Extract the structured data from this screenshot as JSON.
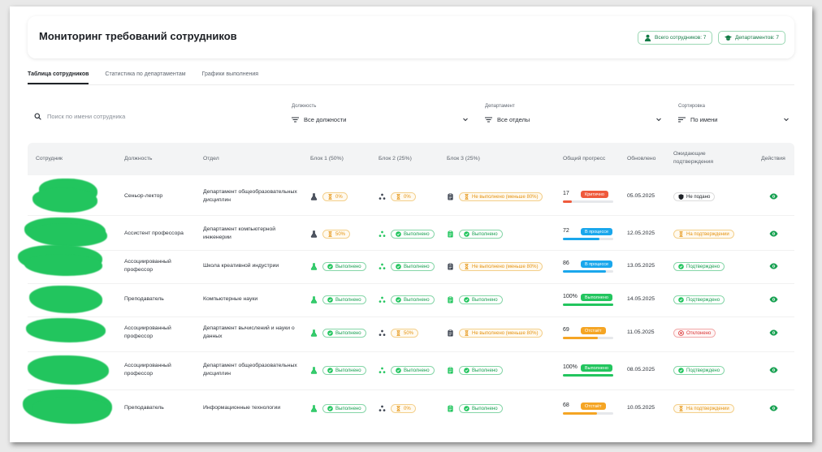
{
  "header": {
    "title": "Мониторинг требований сотрудников",
    "total_employees": "Всего сотрудников: 7",
    "departments": "Департаментов: 7"
  },
  "tabs": [
    {
      "label": "Таблица сотрудников",
      "active": true
    },
    {
      "label": "Статистика по департаментам",
      "active": false
    },
    {
      "label": "Графики выполнения",
      "active": false
    }
  ],
  "filters": {
    "search_placeholder": "Поиск по имени сотрудника",
    "position_label": "Должность",
    "position_value": "Все должности",
    "department_label": "Департамент",
    "department_value": "Все отделы",
    "sort_label": "Сортировка",
    "sort_value": "По имени"
  },
  "columns": {
    "employee": "Сотрудник",
    "position": "Должность",
    "department": "Отдел",
    "block1": "Блок 1 (50%)",
    "block2": "Блок 2 (25%)",
    "block3": "Блок 3 (25%)",
    "progress": "Общий прогресс",
    "updated": "Обновлено",
    "pending": "Ожидающие подтверждения",
    "actions": "Действия"
  },
  "colors": {
    "green": "#22c55e",
    "orange": "#f5a524",
    "red": "#ef5a3c",
    "blue": "#1aa7ec"
  },
  "rows": [
    {
      "position": "Сеньор-лектор",
      "department": "Департамент общеобразовательных дисциплин",
      "block1": {
        "status": "pending",
        "text": "0%"
      },
      "block2": {
        "status": "pending",
        "text": "0%"
      },
      "block3": {
        "status": "pending",
        "text": "Не выполнено (меньше 80%)"
      },
      "progress": {
        "value": 17,
        "label": "17",
        "badge": "Критично",
        "color": "#ef5a3c"
      },
      "updated": "05.05.2025",
      "pending": {
        "status": "dark",
        "text": "Не подано"
      }
    },
    {
      "position": "Ассистент профессора",
      "department": "Департамент компьютерной инженерии",
      "block1": {
        "status": "pending",
        "text": "50%"
      },
      "block2": {
        "status": "done",
        "text": "Выполнено"
      },
      "block3": {
        "status": "done",
        "text": "Выполнено"
      },
      "progress": {
        "value": 72,
        "label": "72",
        "badge": "В процессе",
        "color": "#1aa7ec"
      },
      "updated": "12.05.2025",
      "pending": {
        "status": "pending",
        "text": "На подтверждении"
      }
    },
    {
      "position": "Ассоциированный профессор",
      "department": "Школа креативной индустрии",
      "block1": {
        "status": "done",
        "text": "Выполнено"
      },
      "block2": {
        "status": "done",
        "text": "Выполнено"
      },
      "block3": {
        "status": "pending",
        "text": "Не выполнено (меньше 80%)"
      },
      "progress": {
        "value": 86,
        "label": "86",
        "badge": "В процессе",
        "color": "#1aa7ec"
      },
      "updated": "13.05.2025",
      "pending": {
        "status": "done",
        "text": "Подтверждено"
      }
    },
    {
      "position": "Преподаватель",
      "department": "Компьютерные науки",
      "block1": {
        "status": "done",
        "text": "Выполнено"
      },
      "block2": {
        "status": "done",
        "text": "Выполнено"
      },
      "block3": {
        "status": "done",
        "text": "Выполнено"
      },
      "progress": {
        "value": 100,
        "label": "100%",
        "badge": "Выполнено",
        "color": "#22c55e"
      },
      "updated": "14.05.2025",
      "pending": {
        "status": "done",
        "text": "Подтверждено"
      }
    },
    {
      "position": "Ассоциированный профессор",
      "department": "Департамент вычислений и науки о данных",
      "block1": {
        "status": "done",
        "text": "Выполнено"
      },
      "block2": {
        "status": "pending",
        "text": "50%"
      },
      "block3": {
        "status": "pending",
        "text": "Не выполнено (меньше 80%)"
      },
      "progress": {
        "value": 69,
        "label": "69",
        "badge": "Отстаёт",
        "color": "#f5a524"
      },
      "updated": "11.05.2025",
      "pending": {
        "status": "rejected",
        "text": "Отклонено"
      }
    },
    {
      "position": "Ассоциированный профессор",
      "department": "Департамент общеобразовательных дисциплин",
      "block1": {
        "status": "done",
        "text": "Выполнено"
      },
      "block2": {
        "status": "done",
        "text": "Выполнено"
      },
      "block3": {
        "status": "done",
        "text": "Выполнено"
      },
      "progress": {
        "value": 100,
        "label": "100%",
        "badge": "Выполнено",
        "color": "#22c55e"
      },
      "updated": "08.05.2025",
      "pending": {
        "status": "done",
        "text": "Подтверждено"
      }
    },
    {
      "position": "Преподаватель",
      "department": "Информационные технологии",
      "block1": {
        "status": "done",
        "text": "Выполнено"
      },
      "block2": {
        "status": "pending",
        "text": "0%"
      },
      "block3": {
        "status": "done",
        "text": "Выполнено"
      },
      "progress": {
        "value": 68,
        "label": "68",
        "badge": "Отстаёт",
        "color": "#f5a524"
      },
      "updated": "10.05.2025",
      "pending": {
        "status": "pending",
        "text": "На подтверждении"
      }
    }
  ]
}
